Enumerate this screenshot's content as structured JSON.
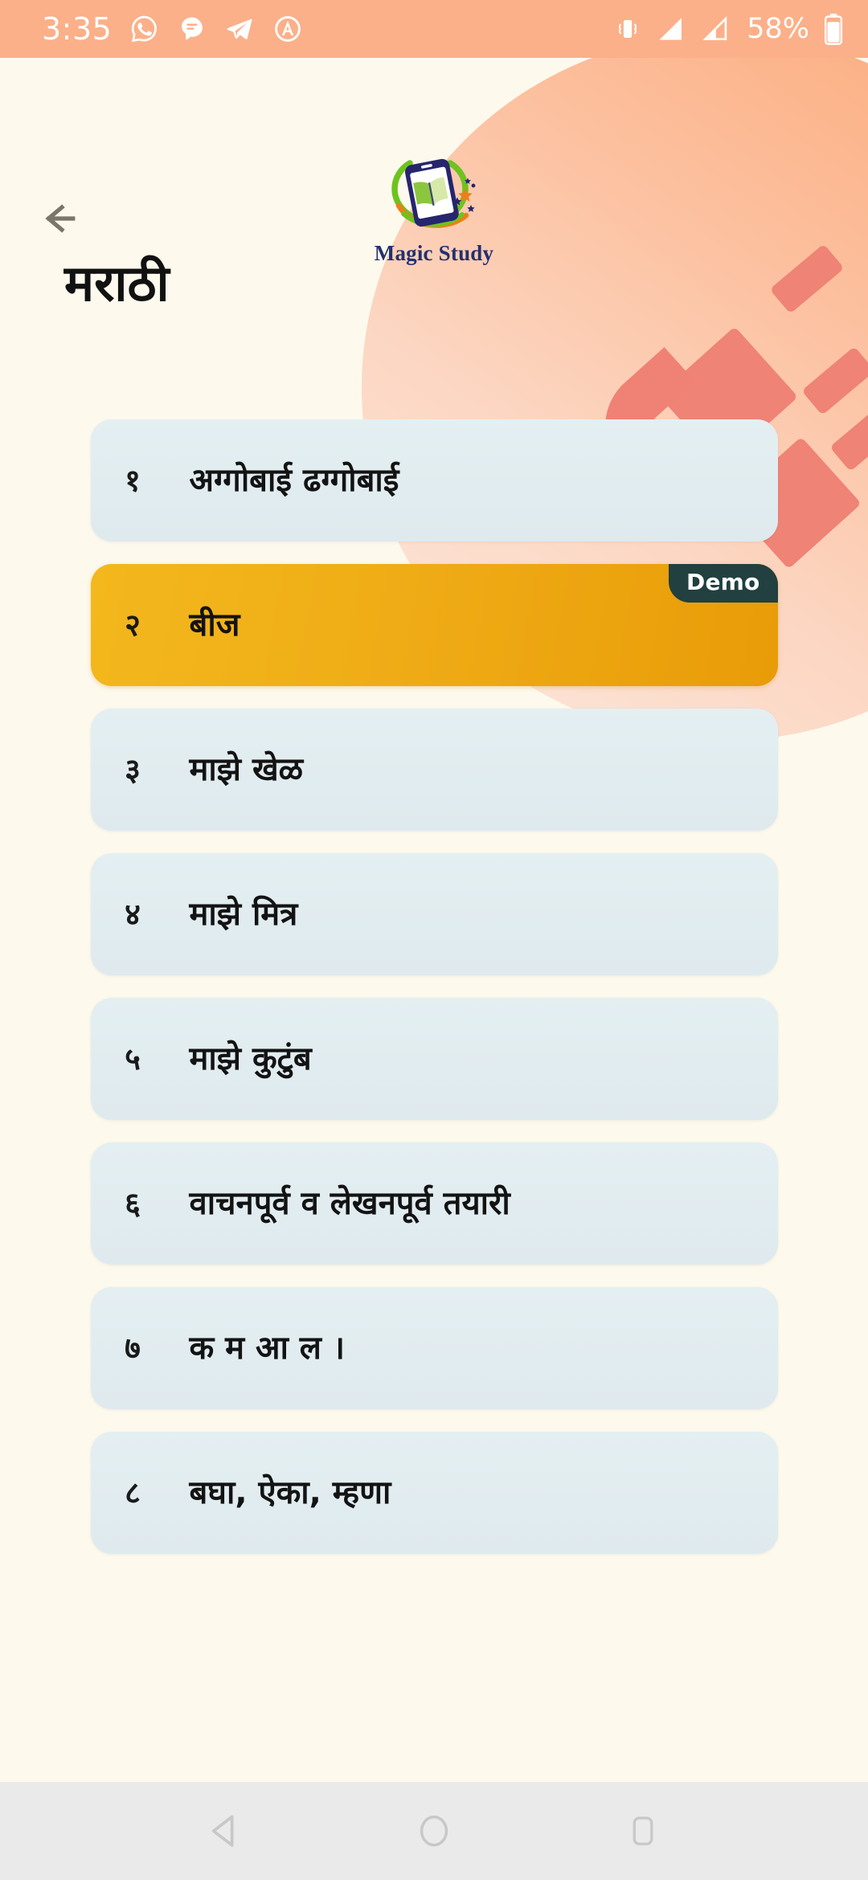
{
  "status_bar": {
    "clock": "3:35",
    "battery_percent": "58%",
    "left_icons": [
      "whatsapp-icon",
      "messages-icon",
      "telegram-icon",
      "arc-app-icon"
    ],
    "right_icons": [
      "vibrate-mode-icon",
      "signal-sim1-icon",
      "signal-sim2-icon",
      "battery-icon"
    ],
    "background_color": "#fbb089",
    "foreground_color": "#ffffff"
  },
  "header": {
    "back_icon": "back-arrow-icon",
    "logo": {
      "mark": "magic-study-logo-mark",
      "wordmark": "Magic Study"
    },
    "title": "मराठी"
  },
  "theme": {
    "page_background": "#fdf9ed",
    "card_background": "#e2edf0",
    "selected_card_color": "#efab15",
    "badge_background": "#21403f",
    "accent_decor": "#ef8375",
    "blob_color": "#fbb089",
    "title_color": "#111111"
  },
  "lessons": [
    {
      "number": "१",
      "title": "अग्गोबाई ढग्गोबाई",
      "selected": false,
      "badge": null
    },
    {
      "number": "२",
      "title": "बीज",
      "selected": true,
      "badge": "Demo"
    },
    {
      "number": "३",
      "title": "माझे खेळ",
      "selected": false,
      "badge": null
    },
    {
      "number": "४",
      "title": "माझे मित्र",
      "selected": false,
      "badge": null
    },
    {
      "number": "५",
      "title": "माझे कुटुंब",
      "selected": false,
      "badge": null
    },
    {
      "number": "६",
      "title": "वाचनपूर्व व लेखनपूर्व तयारी",
      "selected": false,
      "badge": null
    },
    {
      "number": "७",
      "title": "क म आ ल ।",
      "selected": false,
      "badge": null
    },
    {
      "number": "८",
      "title": "बघा, ऐका, म्हणा",
      "selected": false,
      "badge": null
    }
  ],
  "nav_bar": {
    "buttons": [
      {
        "name": "back-nav-button",
        "icon": "triangle-back-icon"
      },
      {
        "name": "home-nav-button",
        "icon": "circle-home-icon"
      },
      {
        "name": "recents-nav-button",
        "icon": "square-recents-icon"
      }
    ],
    "background_color": "#ebeaea"
  }
}
